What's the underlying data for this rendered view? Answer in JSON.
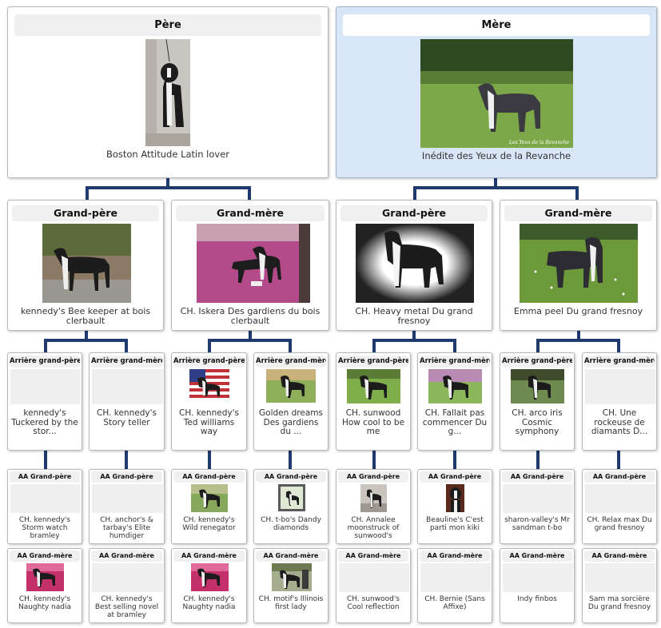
{
  "colors": {
    "connector": "#1f3a6f",
    "highlight_bg": "#d9e6f7",
    "header_bg": "#f0f0f0"
  },
  "parents": [
    {
      "header": "Père",
      "name": "Boston Attitude Latin lover",
      "photo": "standing-dog-photo"
    },
    {
      "header": "Mère",
      "name": "Inédite des Yeux de la Revanche",
      "photo": "dog-on-grass-photo",
      "watermark": "Les Yeux de la Revanche"
    }
  ],
  "grandparents": [
    {
      "header": "Grand-père",
      "name": "kennedy's Bee keeper at bois clerbault"
    },
    {
      "header": "Grand-mère",
      "name": "CH. Iskera Des gardiens du bois clerbault"
    },
    {
      "header": "Grand-père",
      "name": "CH. Heavy metal Du grand fresnoy"
    },
    {
      "header": "Grand-mère",
      "name": "Emma peel Du grand fresnoy"
    }
  ],
  "great_grandparents": [
    {
      "header": "Arrière grand-père",
      "name": "kennedy's Tuckered by the stor..."
    },
    {
      "header": "Arrière grand-mère",
      "name": "CH. kennedy's Story teller"
    },
    {
      "header": "Arrière grand-père",
      "name": "CH. kennedy's Ted williams way"
    },
    {
      "header": "Arrière grand-mère",
      "name": "Golden dreams Des gardiens du ..."
    },
    {
      "header": "Arrière grand-père",
      "name": "CH. sunwood How cool to be me"
    },
    {
      "header": "Arrière grand-mère",
      "name": "CH. Fallait pas commencer Du g..."
    },
    {
      "header": "Arrière grand-père",
      "name": "CH. arco iris Cosmic symphony"
    },
    {
      "header": "Arrière grand-mère",
      "name": "CH. Une rockeuse de diamants D..."
    }
  ],
  "aa_grandfathers": [
    {
      "header": "AA Grand-père",
      "name": "CH. kennedy's Storm watch bramley"
    },
    {
      "header": "AA Grand-père",
      "name": "CH. anchor's & tarbay's Elite humdiger"
    },
    {
      "header": "AA Grand-père",
      "name": "CH. kennedy's Wild renegator"
    },
    {
      "header": "AA Grand-père",
      "name": "CH. t-bo's Dandy diamonds"
    },
    {
      "header": "AA Grand-père",
      "name": "CH. Annalee moonstruck of sunwood's"
    },
    {
      "header": "AA Grand-père",
      "name": "Beauline's C'est parti mon kiki"
    },
    {
      "header": "AA Grand-père",
      "name": "sharon-valley's Mr sandman t-bo"
    },
    {
      "header": "AA Grand-père",
      "name": "CH. Relax max Du grand fresnoy"
    }
  ],
  "aa_grandmothers": [
    {
      "header": "AA Grand-mère",
      "name": "CH. kennedy's Naughty nadia"
    },
    {
      "header": "AA Grand-mère",
      "name": "CH. kennedy's Best selling novel at bramley"
    },
    {
      "header": "AA Grand-mère",
      "name": "CH. kennedy's Naughty nadia"
    },
    {
      "header": "AA Grand-mère",
      "name": "CH. motif's Illinois first lady"
    },
    {
      "header": "AA Grand-mère",
      "name": "CH. sunwood's Cool reflection"
    },
    {
      "header": "AA Grand-mère",
      "name": "CH. Bernie (Sans Affixe)"
    },
    {
      "header": "AA Grand-mère",
      "name": "Indy finbos"
    },
    {
      "header": "AA Grand-mère",
      "name": "Sam ma sorcière Du grand fresnoy"
    }
  ]
}
